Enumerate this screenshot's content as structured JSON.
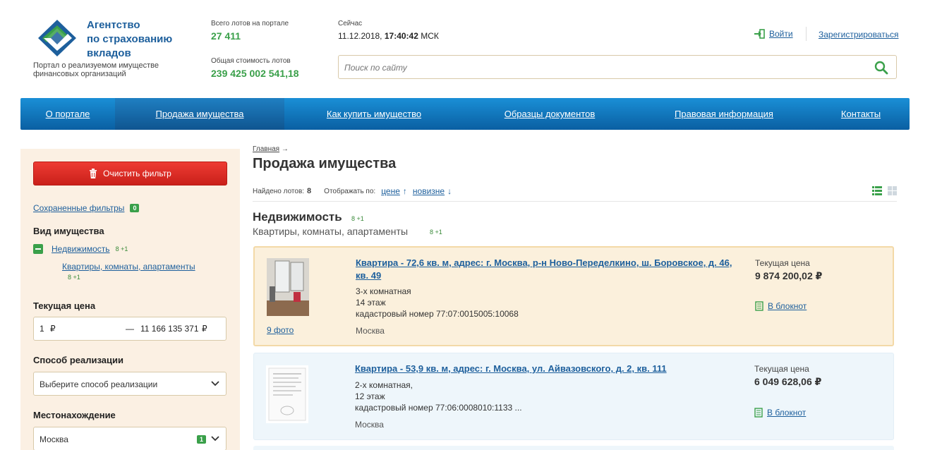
{
  "header": {
    "logo_name_lines": [
      "Агентство",
      "по страхованию",
      "вкладов"
    ],
    "logo_sub": "Портал о реализуемом имуществе финансовых организаций",
    "total_lots_label": "Всего лотов на портале",
    "total_lots_value": "27 411",
    "total_cost_label": "Общая стоимость лотов",
    "total_cost_value": "239 425 002 541,18",
    "now_label": "Сейчас",
    "now_date": "11.12.2018,",
    "now_time": "17:40:42",
    "now_tz": "МСК",
    "search_placeholder": "Поиск по сайту",
    "login": "Войти",
    "register": "Зарегистрироваться"
  },
  "nav": {
    "items": [
      {
        "label": "О портале"
      },
      {
        "label": "Продажа имущества",
        "active": true
      },
      {
        "label": "Как купить имущество"
      },
      {
        "label": "Образцы документов"
      },
      {
        "label": "Правовая информация"
      },
      {
        "label": "Контакты"
      }
    ]
  },
  "sidebar": {
    "clear_filter": "Очистить фильтр",
    "saved_filters": "Сохраненные фильтры",
    "saved_filters_count": "0",
    "property_type_heading": "Вид имущества",
    "real_estate": "Недвижимость",
    "real_estate_count": "8 +1",
    "apartments": "Квартиры, комнаты, апартаменты",
    "apartments_count": "8 +1",
    "current_price_heading": "Текущая цена",
    "price_from": "1",
    "price_from_currency": "₽",
    "price_dash": "—",
    "price_to": "11 166 135 371",
    "price_to_currency": "₽",
    "method_heading": "Способ реализации",
    "method_value": "Выберите способ реализации",
    "location_heading": "Местонахождение",
    "location_value": "Москва",
    "location_count": "1"
  },
  "main": {
    "breadcrumb_home": "Главная",
    "breadcrumb_arrow": "→",
    "title": "Продажа имущества",
    "found_label": "Найдено лотов:",
    "found_value": "8",
    "show_by_label": "Отображать по:",
    "sort_price": "цене",
    "sort_price_arrow": "↑",
    "sort_new": "новизне",
    "sort_new_arrow": "↓",
    "category": "Недвижимость",
    "category_count": "8 +1",
    "subcategory": "Квартиры, комнаты, апартаменты",
    "subcategory_count": "8 +1",
    "lots": [
      {
        "title": "Квартира - 72,6 кв. м, адрес: г. Москва, р-н Ново-Переделкино, ш. Боровское, д. 46, кв. 49",
        "lines": [
          "3-х комнатная",
          "14 этаж",
          "кадастровый номер 77:07:0015005:10068"
        ],
        "city": "Москва",
        "photos": "9 фото",
        "price_label": "Текущая цена",
        "price": "9 874 200,02 ₽",
        "notebook": "В блокнот"
      },
      {
        "title": "Квартира - 53,9 кв. м, адрес: г. Москва, ул. Айвазовского, д. 2, кв. 111",
        "lines": [
          "2-х комнатная,",
          "12 этаж",
          "кадастровый номер 77:06:0008010:1133 ..."
        ],
        "city": "Москва",
        "price_label": "Текущая цена",
        "price": "6 049 628,06 ₽",
        "notebook": "В блокнот"
      }
    ]
  },
  "colors": {
    "brand_blue": "#1d5f9c",
    "accent_green": "#3aa04a",
    "nav_blue": "#0a6fb8",
    "danger_red": "#dd2c25",
    "sidebar_bg": "#fbf0e3"
  }
}
